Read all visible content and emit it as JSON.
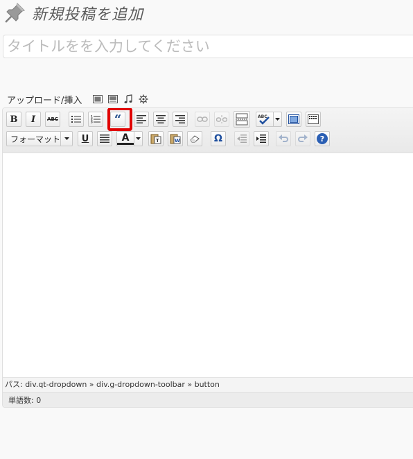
{
  "page": {
    "title": "新規投稿を追加",
    "title_placeholder": "タイトルをを入力してください"
  },
  "upload": {
    "label": "アップロード/挿入",
    "icons": [
      "image-icon",
      "video-icon",
      "music-icon",
      "media-gear-icon"
    ]
  },
  "toolbar": {
    "row1": [
      {
        "name": "bold",
        "label": "B"
      },
      {
        "name": "italic",
        "label": "I"
      },
      {
        "name": "strikethrough",
        "label": "ABC"
      },
      {
        "name": "bullet-list"
      },
      {
        "name": "numbered-list"
      },
      {
        "name": "blockquote",
        "label": "“",
        "highlighted": true
      },
      {
        "name": "align-left"
      },
      {
        "name": "align-center"
      },
      {
        "name": "align-right"
      },
      {
        "name": "insert-link",
        "disabled": true
      },
      {
        "name": "unlink",
        "disabled": true
      },
      {
        "name": "insert-more"
      },
      {
        "name": "spellcheck"
      },
      {
        "name": "fullscreen"
      },
      {
        "name": "kitchen-sink"
      }
    ],
    "row2": [
      {
        "name": "format-select"
      },
      {
        "name": "underline",
        "label": "U"
      },
      {
        "name": "justify"
      },
      {
        "name": "text-color",
        "label": "A"
      },
      {
        "name": "paste-text"
      },
      {
        "name": "paste-word"
      },
      {
        "name": "remove-format"
      },
      {
        "name": "special-character",
        "label": "Ω"
      },
      {
        "name": "outdent",
        "disabled": true
      },
      {
        "name": "indent"
      },
      {
        "name": "undo",
        "disabled": true
      },
      {
        "name": "redo",
        "disabled": true
      },
      {
        "name": "help",
        "label": "?"
      }
    ],
    "format_label": "フォーマット"
  },
  "editor": {
    "path": "パス: div.qt-dropdown » div.g-dropdown-toolbar » button",
    "word_count": "単語数: 0"
  },
  "colors": {
    "highlight": "#e00000",
    "background": "#f9f9f9",
    "toolbar": "#f0f0f0"
  }
}
